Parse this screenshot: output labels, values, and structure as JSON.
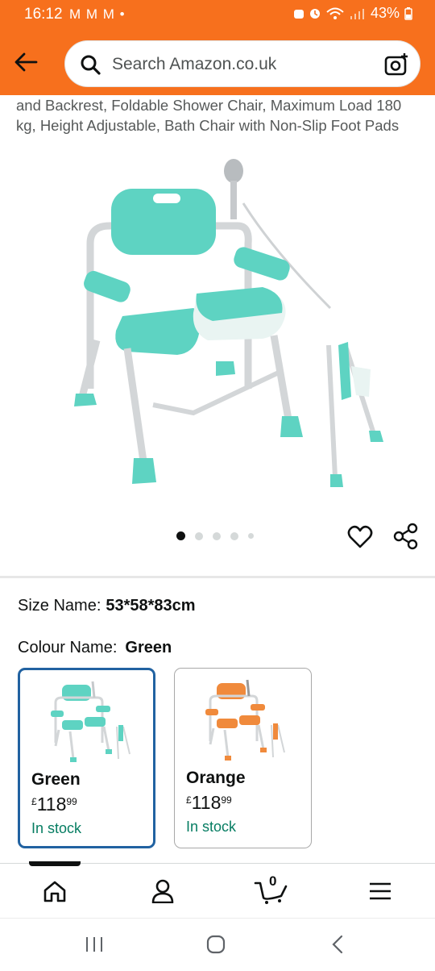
{
  "status_bar": {
    "time": "16:12",
    "notifications": "M M M •",
    "battery": "43%"
  },
  "search": {
    "placeholder": "Search Amazon.co.uk"
  },
  "product": {
    "title_fragment": "and Backrest, Foldable Shower Chair, Maximum Load 180 kg, Height Adjustable, Bath Chair with Non-Slip Foot Pads",
    "image_count": 5,
    "active_image_index": 0
  },
  "variations": {
    "size_label": "Size Name:",
    "size_value": "53*58*83cm",
    "colour_label": "Colour Name:",
    "colour_value": "Green",
    "options": [
      {
        "name": "Green",
        "currency": "£",
        "price_whole": "118",
        "price_fraction": "99",
        "availability": "In stock",
        "selected": true,
        "accent_color": "#5ed3c2"
      },
      {
        "name": "Orange",
        "currency": "£",
        "price_whole": "118",
        "price_fraction": "99",
        "availability": "In stock",
        "selected": false,
        "accent_color": "#f08a3c"
      }
    ]
  },
  "bottom_nav": {
    "cart_count": "0",
    "items": [
      "home-icon",
      "account-icon",
      "cart-icon",
      "menu-icon"
    ]
  },
  "colors": {
    "brand_orange": "#f7701d",
    "link_blue": "#2162a1",
    "stock_green": "#067d62",
    "chair_teal": "#5ed3c2"
  }
}
